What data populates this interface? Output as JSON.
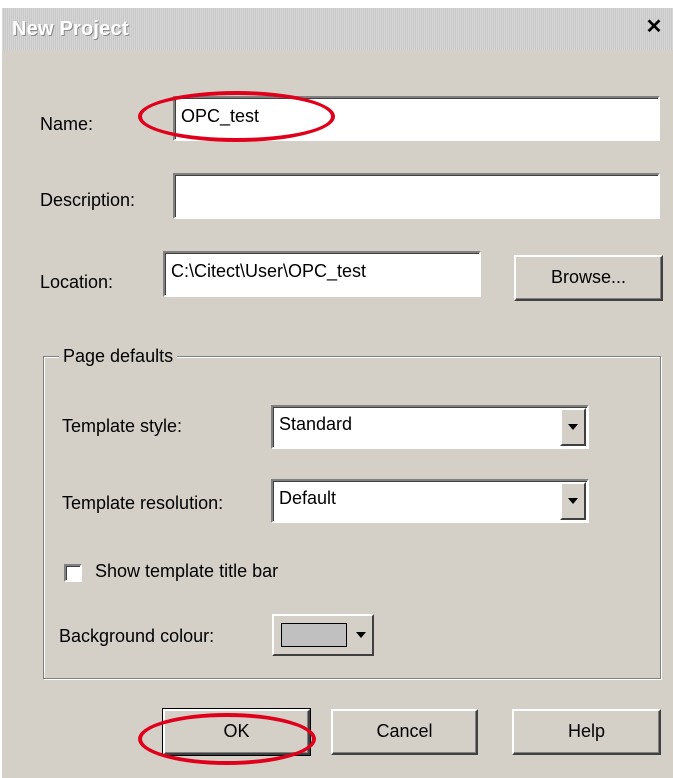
{
  "window": {
    "title": "New Project",
    "close_label": "✕"
  },
  "form": {
    "name_label": "Name:",
    "name_value": "OPC_test",
    "description_label": "Description:",
    "description_value": "",
    "location_label": "Location:",
    "location_value": "C:\\Citect\\User\\OPC_test",
    "browse_label": "Browse..."
  },
  "page_defaults": {
    "group_label": "Page defaults",
    "template_style_label": "Template style:",
    "template_style_value": "Standard",
    "template_resolution_label": "Template resolution:",
    "template_resolution_value": "Default",
    "show_title_bar_label": "Show template title bar",
    "show_title_bar_checked": false,
    "background_colour_label": "Background colour:",
    "background_colour_value": "#c0c0c0"
  },
  "buttons": {
    "ok_label": "OK",
    "cancel_label": "Cancel",
    "help_label": "Help"
  },
  "annotation_color": "#e0001b"
}
